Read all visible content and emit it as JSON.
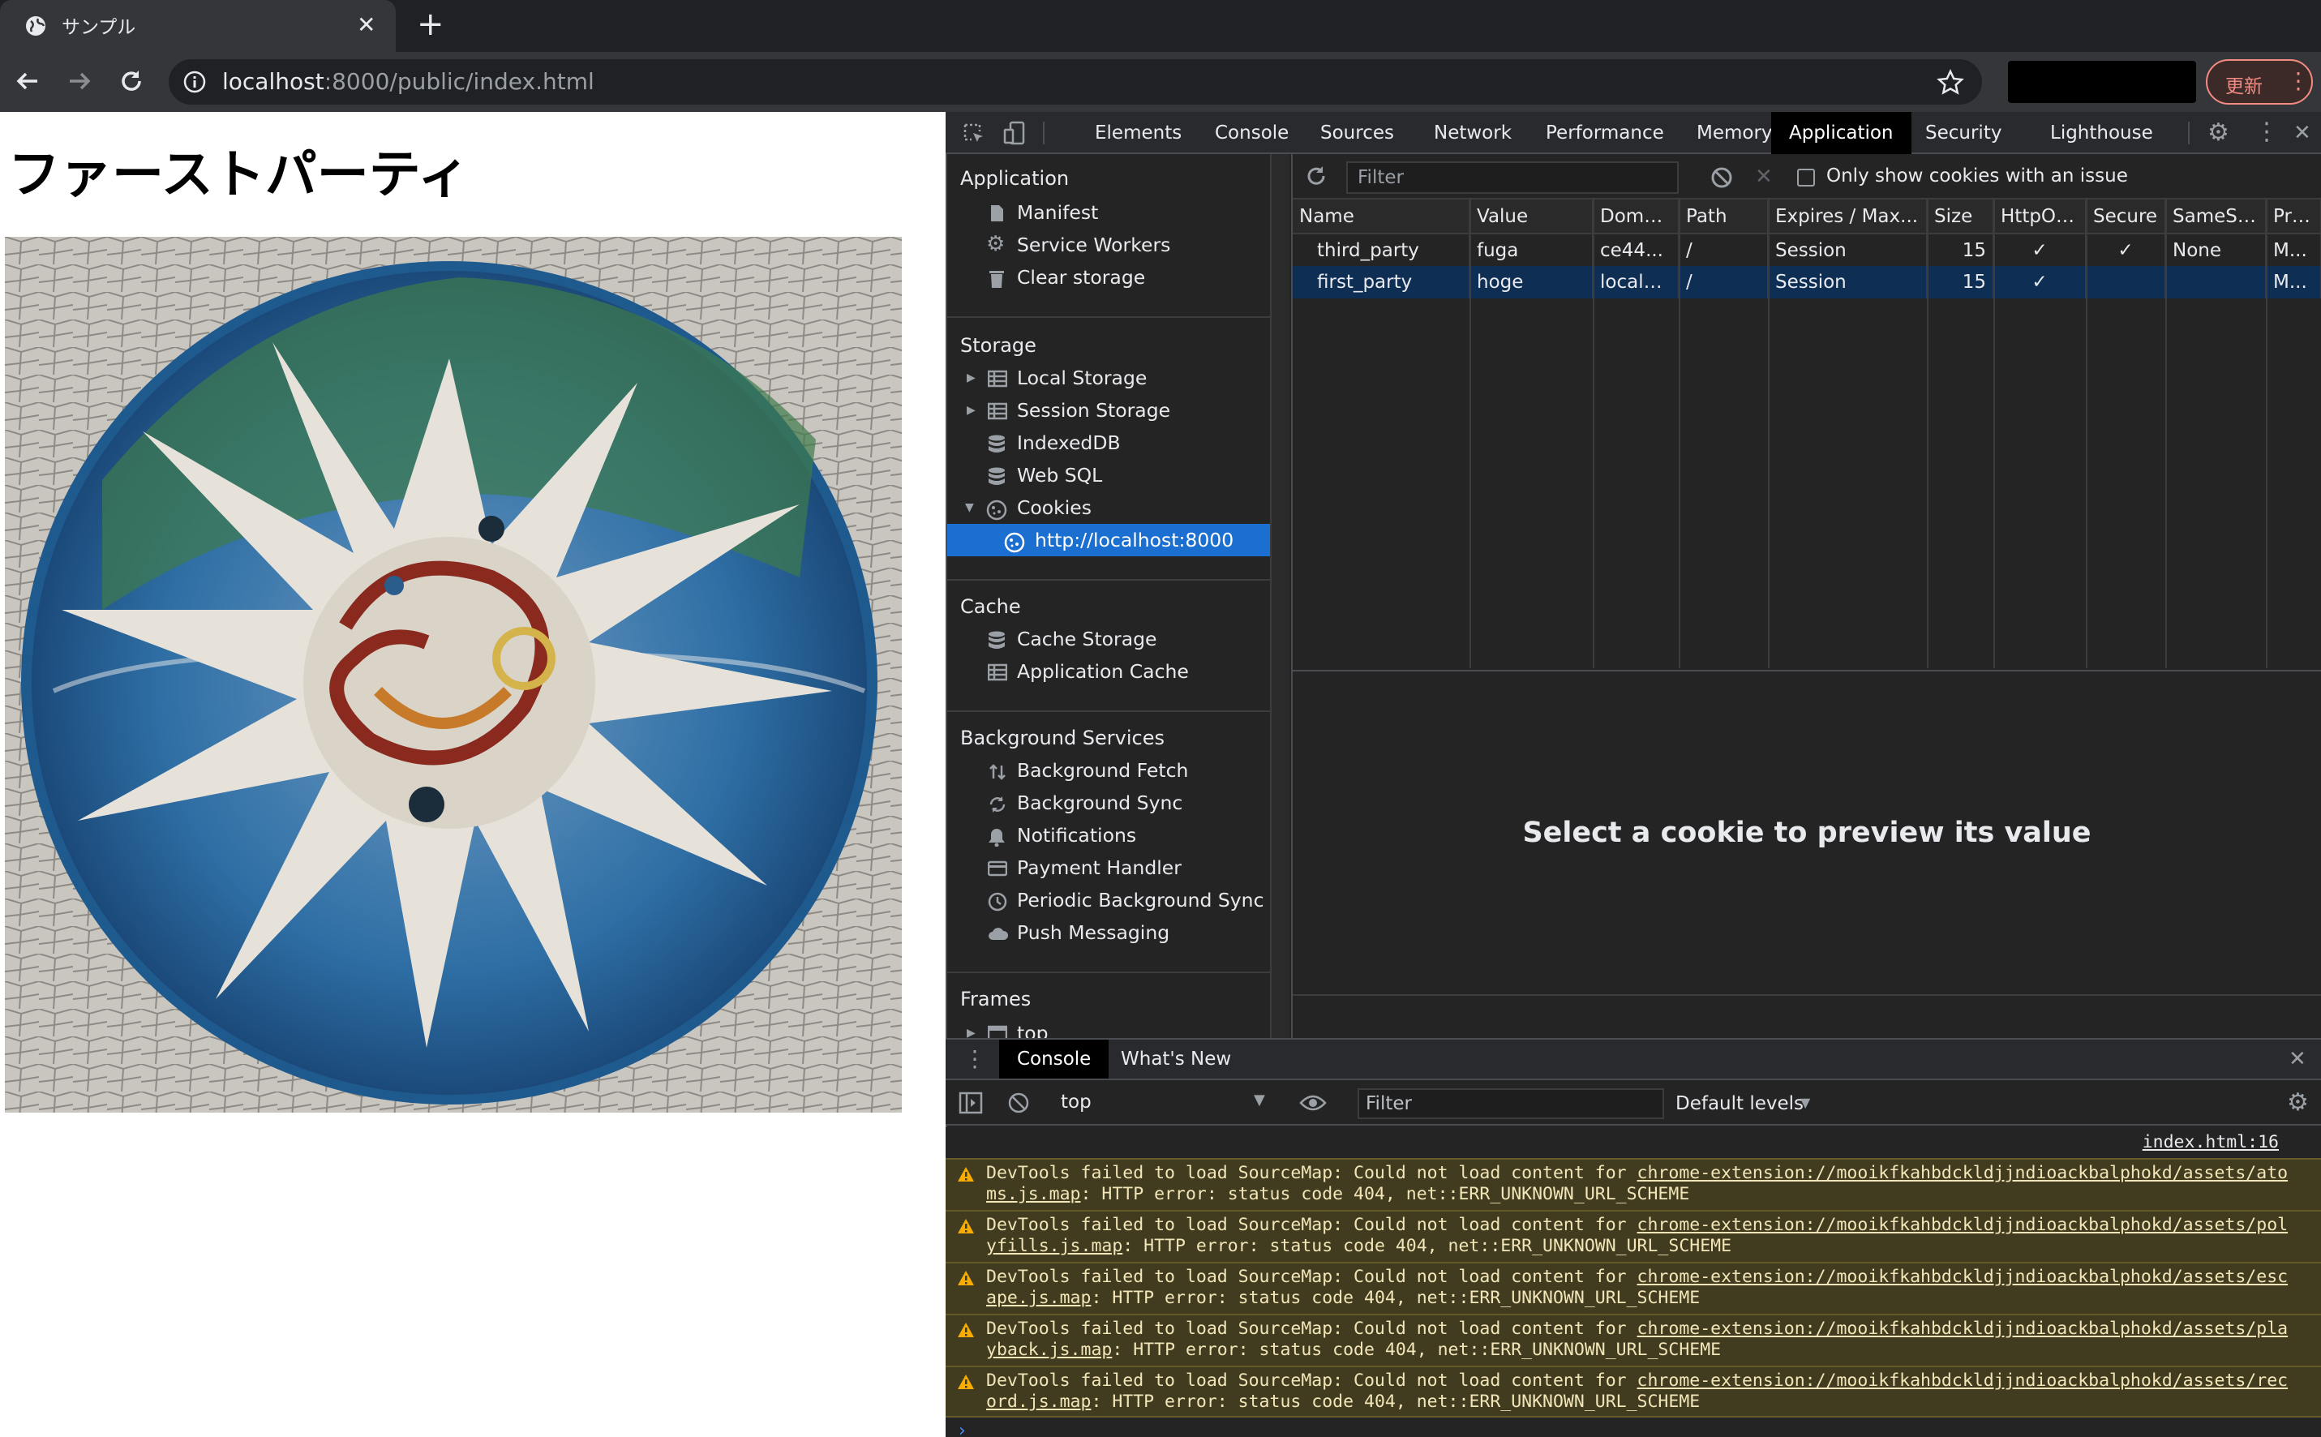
{
  "browser": {
    "tab_title": "サンプル",
    "url_host": "localhost",
    "url_rest": ":8000/public/index.html",
    "update_label": "更新"
  },
  "page": {
    "heading": "ファーストパーティ"
  },
  "devtools": {
    "tabs": [
      "Elements",
      "Console",
      "Sources",
      "Network",
      "Performance",
      "Memory",
      "Application",
      "Security",
      "Lighthouse"
    ],
    "active_tab": "Application",
    "sidebar": {
      "application": {
        "title": "Application",
        "items": [
          "Manifest",
          "Service Workers",
          "Clear storage"
        ]
      },
      "storage": {
        "title": "Storage",
        "items": [
          "Local Storage",
          "Session Storage",
          "IndexedDB",
          "Web SQL",
          "Cookies"
        ],
        "cookie_origin": "http://localhost:8000"
      },
      "cache": {
        "title": "Cache",
        "items": [
          "Cache Storage",
          "Application Cache"
        ]
      },
      "background": {
        "title": "Background Services",
        "items": [
          "Background Fetch",
          "Background Sync",
          "Notifications",
          "Payment Handler",
          "Periodic Background Sync",
          "Push Messaging"
        ]
      },
      "frames": {
        "title": "Frames",
        "items": [
          "top"
        ]
      }
    },
    "cookies": {
      "filter_placeholder": "Filter",
      "only_issues_label": "Only show cookies with an issue",
      "columns": [
        "Name",
        "Value",
        "Domain",
        "Path",
        "Expires / Max...",
        "Size",
        "HttpOnly",
        "Secure",
        "SameSite",
        "Pri..."
      ],
      "rows": [
        {
          "name": "third_party",
          "value": "fuga",
          "domain": "ce44...",
          "path": "/",
          "expires": "Session",
          "size": "15",
          "httponly": "✓",
          "secure": "✓",
          "samesite": "None",
          "priority": "M..."
        },
        {
          "name": "first_party",
          "value": "hoge",
          "domain": "localh...",
          "path": "/",
          "expires": "Session",
          "size": "15",
          "httponly": "✓",
          "secure": "",
          "samesite": "",
          "priority": "M..."
        }
      ],
      "selected_row": 1,
      "preview_text": "Select a cookie to preview its value"
    },
    "drawer": {
      "tabs": [
        "Console",
        "What's New"
      ],
      "active_tab": "Console",
      "context": "top",
      "filter_placeholder": "Filter",
      "levels": "Default levels",
      "source_link": "index.html:16",
      "messages": [
        {
          "prefix": "DevTools failed to load SourceMap: Could not load content for ",
          "url": "chrome-extension://mooikfkahbdckldjjndioackbalphokd/assets/atoms.js.map",
          "suffix": ": HTTP error: status code 404, net::ERR_UNKNOWN_URL_SCHEME"
        },
        {
          "prefix": "DevTools failed to load SourceMap: Could not load content for ",
          "url": "chrome-extension://mooikfkahbdckldjjndioackbalphokd/assets/polyfills.js.map",
          "suffix": ": HTTP error: status code 404, net::ERR_UNKNOWN_URL_SCHEME"
        },
        {
          "prefix": "DevTools failed to load SourceMap: Could not load content for ",
          "url": "chrome-extension://mooikfkahbdckldjjndioackbalphokd/assets/escape.js.map",
          "suffix": ": HTTP error: status code 404, net::ERR_UNKNOWN_URL_SCHEME"
        },
        {
          "prefix": "DevTools failed to load SourceMap: Could not load content for ",
          "url": "chrome-extension://mooikfkahbdckldjjndioackbalphokd/assets/playback.js.map",
          "suffix": ": HTTP error: status code 404, net::ERR_UNKNOWN_URL_SCHEME"
        },
        {
          "prefix": "DevTools failed to load SourceMap: Could not load content for ",
          "url": "chrome-extension://mooikfkahbdckldjjndioackbalphokd/assets/record.js.map",
          "suffix": ": HTTP error: status code 404, net::ERR_UNKNOWN_URL_SCHEME"
        }
      ]
    }
  },
  "colors": {
    "selection": "#0e2e54",
    "sidebar_selected": "#1a6fd1",
    "warning_bg": "#413c1f",
    "warning_icon": "#f9ab00"
  }
}
